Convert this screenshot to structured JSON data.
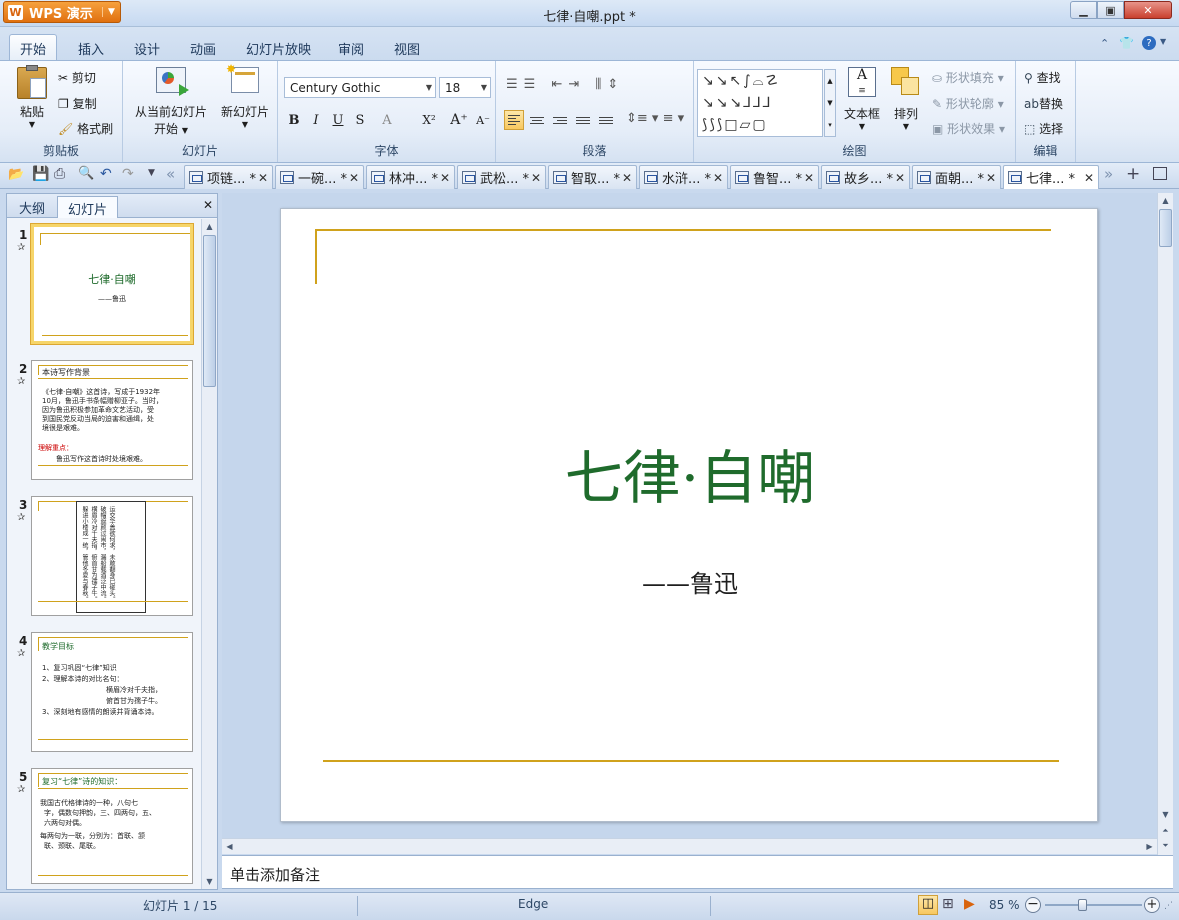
{
  "window": {
    "app_name": "WPS 演示",
    "doc_title": "七律·自嘲.ppt *"
  },
  "menu": {
    "tabs": [
      "开始",
      "插入",
      "设计",
      "动画",
      "幻灯片放映",
      "审阅",
      "视图"
    ]
  },
  "ribbon": {
    "clipboard": {
      "paste": "粘贴",
      "cut": "剪切",
      "copy": "复制",
      "format_painter": "格式刷",
      "label": "剪贴板"
    },
    "slides": {
      "from_current": "从当前幻灯片",
      "start": "开始",
      "new_slide": "新幻灯片",
      "label": "幻灯片"
    },
    "font": {
      "name": "Century Gothic",
      "size": "18",
      "label": "字体"
    },
    "paragraph": {
      "label": "段落"
    },
    "drawing": {
      "text_box": "文本框",
      "arrange": "排列",
      "shape_fill": "形状填充",
      "shape_outline": "形状轮廓",
      "shape_effect": "形状效果",
      "label": "绘图"
    },
    "editing": {
      "find": "查找",
      "replace": "替换",
      "select": "选择",
      "label": "编辑"
    }
  },
  "doc_tabs": [
    "项链... *",
    "一碗... *",
    "林冲... *",
    "武松... *",
    "智取... *",
    "水浒... *",
    "鲁智... *",
    "故乡... *",
    "面朝... *",
    "七律... *"
  ],
  "left_panel": {
    "tabs": [
      "大纲",
      "幻灯片"
    ],
    "slides": [
      {
        "num": "1",
        "title": "七律·自嘲",
        "sub": "——鲁迅"
      },
      {
        "num": "2",
        "title": "本诗写作背景",
        "lines": [
          "《七律·自嘲》这首诗，写成于1932年",
          "10月，鲁迅手书条幅赠柳亚子。当时，",
          "因为鲁迅积极参加革命文艺活动，受",
          "到国民党反动当局的迫害和通缉，处",
          "境很是艰难。"
        ],
        "key_label": "理解重点：",
        "key_text": "鲁迅写作这首诗时处境艰难。"
      },
      {
        "num": "3",
        "vertical_text": "运交华盖欲何求，未敢翻身已碰头。破帽遮颜过闹市，漏船载酒泛中流。横眉冷对千夫指，俯首甘为孺子牛。躲进小楼成一统，管他冬夏与春秋。"
      },
      {
        "num": "4",
        "title": "教学目标",
        "lines": [
          "1、复习巩固“七律”知识",
          "2、理解本诗的对比名句：",
          "横眉冷对千夫指，",
          "俯首甘为孺子牛。",
          "3、深刻地有感情的朗读并背诵本诗。"
        ]
      },
      {
        "num": "5",
        "title": "复习“七律”诗的知识：",
        "lines": [
          "我国古代格律诗的一种，八句七",
          "字，偶数句押韵，三、四两句，五、",
          "六两句对偶。",
          "每两句为一联，分别为：首联、颔",
          "联、颈联、尾联。"
        ]
      }
    ]
  },
  "slide": {
    "title": "七律·自嘲",
    "subtitle": "——鲁迅"
  },
  "notes_placeholder": "单击添加备注",
  "status": {
    "slide_info": "幻灯片 1 / 15",
    "theme": "Edge",
    "zoom": "85 %"
  },
  "colors": {
    "accent_line": "#d0a21c",
    "title_green": "#1f6b2c"
  }
}
